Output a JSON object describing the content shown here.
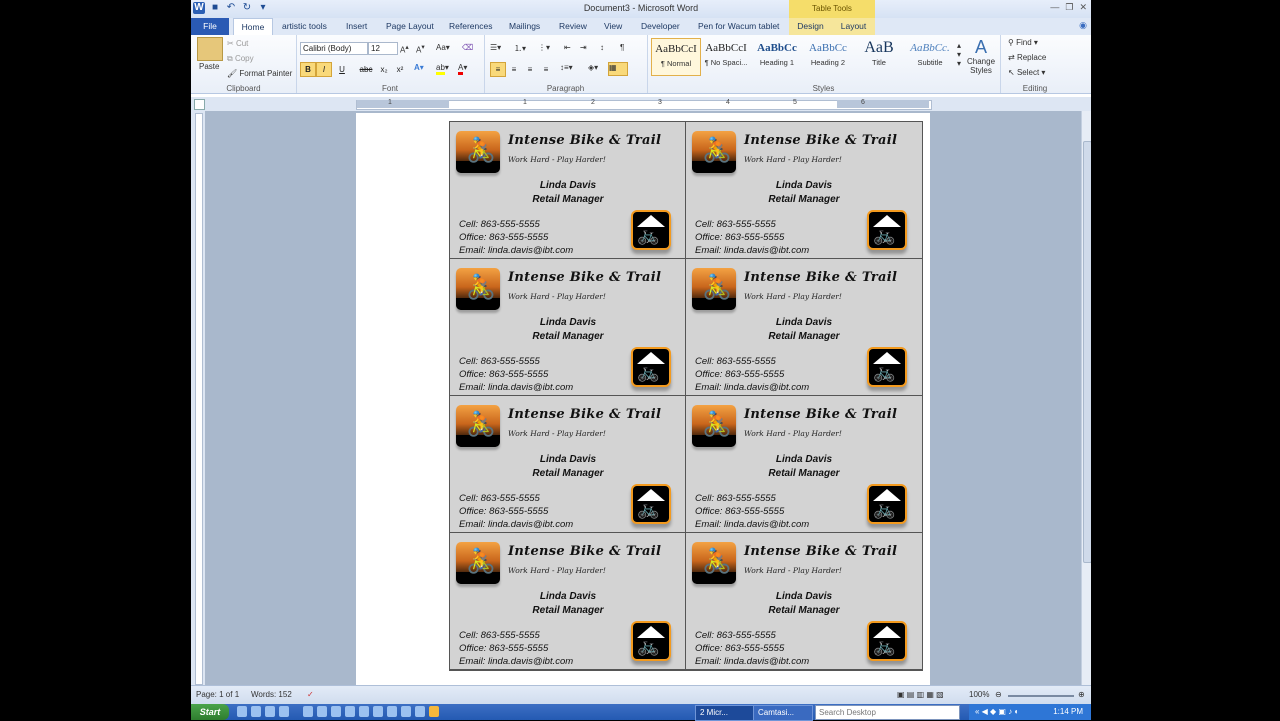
{
  "window": {
    "title": "Document3 - Microsoft Word",
    "contextual_tab": "Table Tools"
  },
  "tabs": [
    {
      "label": "File"
    },
    {
      "label": "Home"
    },
    {
      "label": "artistic tools"
    },
    {
      "label": "Insert"
    },
    {
      "label": "Page Layout"
    },
    {
      "label": "References"
    },
    {
      "label": "Mailings"
    },
    {
      "label": "Review"
    },
    {
      "label": "View"
    },
    {
      "label": "Developer"
    },
    {
      "label": "Pen for Wacum tablet"
    },
    {
      "label": "Design"
    },
    {
      "label": "Layout"
    }
  ],
  "ribbon": {
    "clipboard": {
      "paste": "Paste",
      "cut": "Cut",
      "copy": "Copy",
      "format_painter": "Format Painter",
      "label": "Clipboard"
    },
    "font": {
      "name": "Calibri (Body)",
      "size": "12",
      "label": "Font",
      "bold": "B",
      "italic": "I",
      "underline": "U",
      "strike": "abc",
      "sub": "x₂",
      "sup": "x²"
    },
    "paragraph": {
      "label": "Paragraph"
    },
    "styles": {
      "label": "Styles",
      "items": [
        {
          "preview": "AaBbCcI",
          "name": "¶ Normal"
        },
        {
          "preview": "AaBbCcI",
          "name": "¶ No Spaci..."
        },
        {
          "preview": "AaBbCc",
          "name": "Heading 1"
        },
        {
          "preview": "AaBbCc",
          "name": "Heading 2"
        },
        {
          "preview": "AaB",
          "name": "Title"
        },
        {
          "preview": "AaBbCc.",
          "name": "Subtitle"
        }
      ],
      "change": "Change Styles"
    },
    "editing": {
      "find": "Find",
      "replace": "Replace",
      "select": "Select",
      "label": "Editing"
    }
  },
  "ruler_numbers": [
    "1",
    "1",
    "2",
    "3",
    "4",
    "5",
    "6"
  ],
  "card": {
    "company": "Intense Bike & Trail",
    "slogan": "Work Hard - Play Harder!",
    "name": "Linda Davis",
    "title": "Retail Manager",
    "cell": "Cell:  863-555-5555",
    "office": "Office:  863-555-5555",
    "email": "Email:  linda.davis@ibt.com"
  },
  "status": {
    "page": "Page: 1 of 1",
    "words": "Words: 152",
    "zoom": "100%"
  },
  "taskbar": {
    "start": "Start",
    "tasks": [
      "2 Micr...",
      "Camtasi..."
    ],
    "search_placeholder": "Search Desktop",
    "clock": "1:14 PM"
  }
}
